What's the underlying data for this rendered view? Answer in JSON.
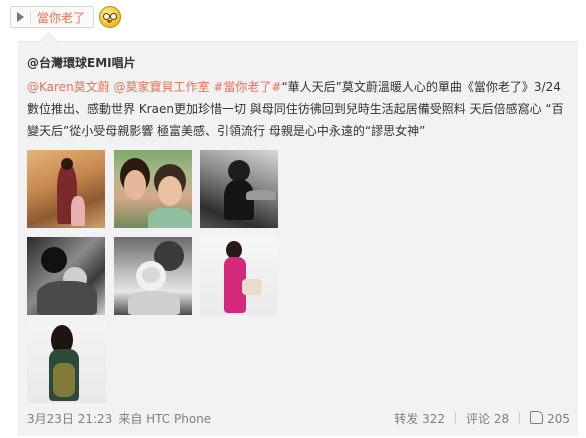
{
  "audio": {
    "label": "當你老了",
    "play_icon": "play-icon"
  },
  "emoji": {
    "icon": "shy-face-emoji-icon"
  },
  "post": {
    "author": "@台灣環球EMI唱片",
    "mention1": "@Karen莫文蔚",
    "mention2": "@莫家寶貝工作室",
    "topic": "#當你老了#",
    "text1": "“華人天后”莫文蔚溫暖人心的單曲《當你老了》3/24數位推出、感動世界 Kraen更加珍惜一切 與母同住彷彿回到兒時生活起居備受照料 天后倍感窩心 “百變天后”從小受母親影響 極富美感、引領流行 母親是心中永遠的“謬思女神”"
  },
  "footer": {
    "time": "3月23日 21:23",
    "source": "来自 HTC Phone",
    "repost": "转发 322",
    "comment": "评论 28",
    "like": "205",
    "like_icon": "thumbs-up-icon"
  }
}
